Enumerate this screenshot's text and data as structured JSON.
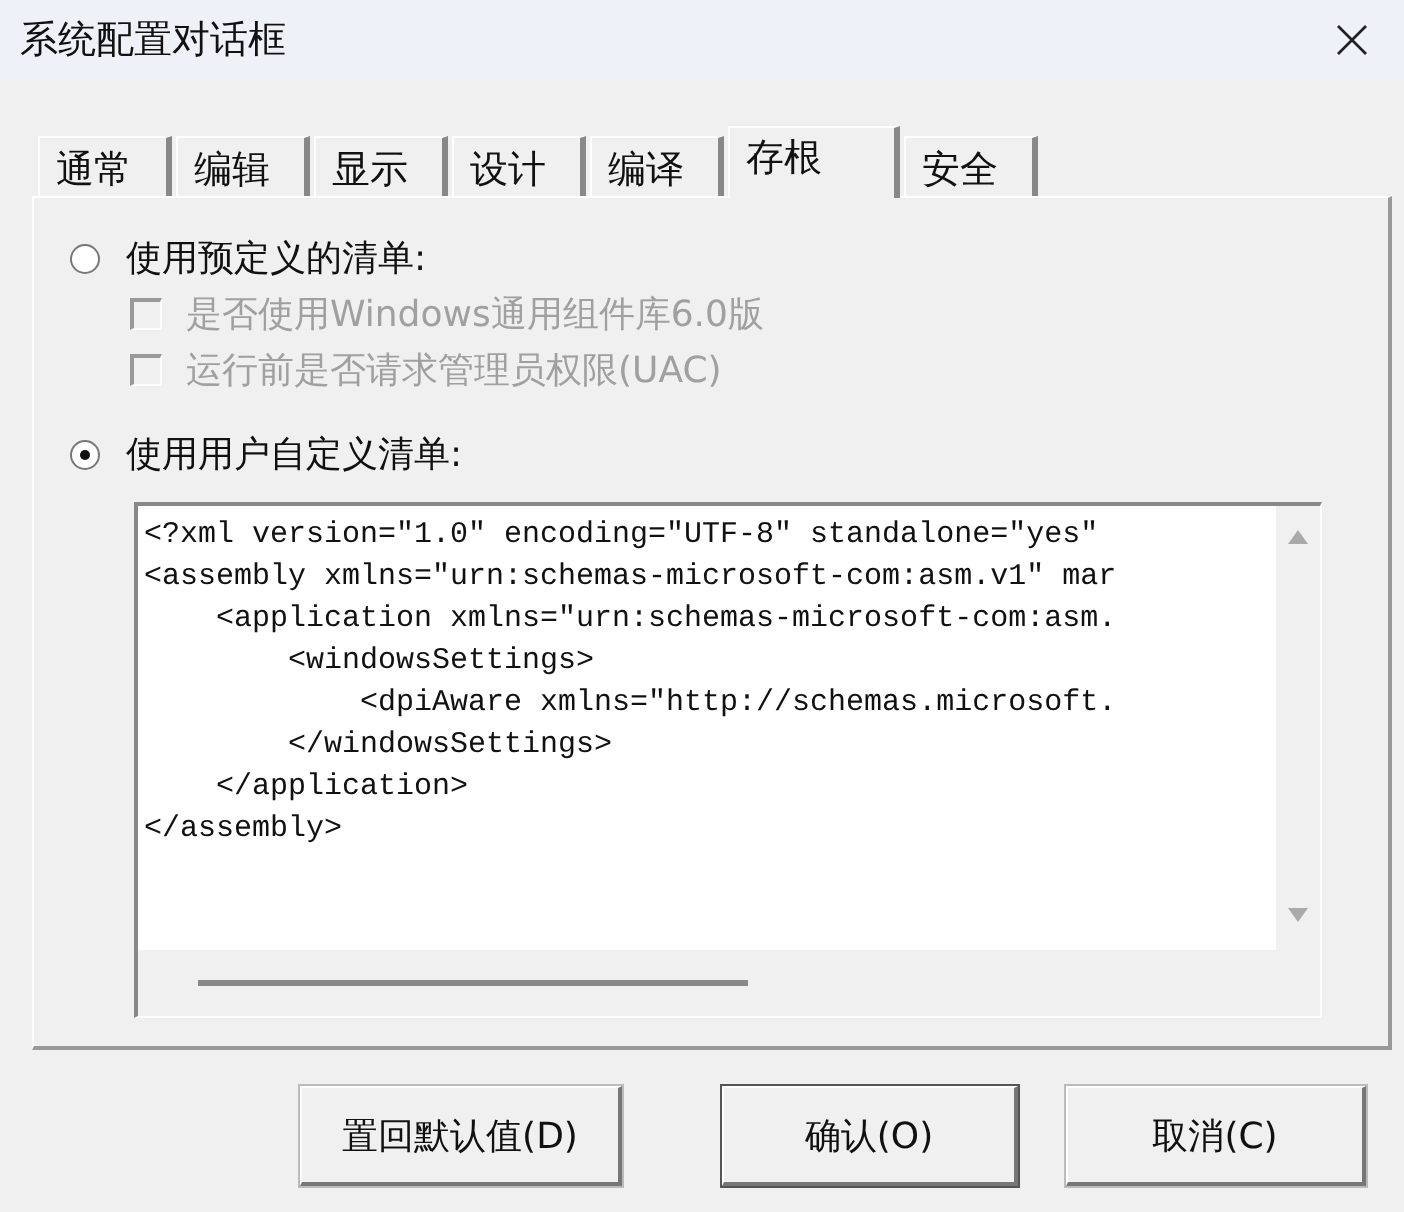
{
  "window": {
    "title": "系统配置对话框"
  },
  "tabs": [
    {
      "label": "通常",
      "selected": false
    },
    {
      "label": "编辑",
      "selected": false
    },
    {
      "label": "显示",
      "selected": false
    },
    {
      "label": "设计",
      "selected": false
    },
    {
      "label": "编译",
      "selected": false
    },
    {
      "label": "存根",
      "selected": true
    },
    {
      "label": "安全",
      "selected": false
    }
  ],
  "options": [
    {
      "kind": "radio",
      "label": "使用预定义的清单:",
      "selected": false,
      "children": [
        {
          "kind": "checkbox",
          "label": "是否使用Windows通用组件库6.0版",
          "checked": false,
          "disabled": true
        },
        {
          "kind": "checkbox",
          "label": "运行前是否请求管理员权限(UAC)",
          "checked": false,
          "disabled": true
        }
      ]
    },
    {
      "kind": "radio",
      "label": "使用用户自定义清单:",
      "selected": true
    }
  ],
  "manifest_editor": {
    "lines": [
      "<?xml version=\"1.0\" encoding=\"UTF-8\" standalone=\"yes\"",
      "<assembly xmlns=\"urn:schemas-microsoft-com:asm.v1\" mar",
      "    <application xmlns=\"urn:schemas-microsoft-com:asm.",
      "        <windowsSettings>",
      "            <dpiAware xmlns=\"http://schemas.microsoft.",
      "        </windowsSettings>",
      "    </application>",
      "</assembly>"
    ]
  },
  "buttons": [
    {
      "label": "置回默认值(D)",
      "default": false
    },
    {
      "label": "确认(O)",
      "default": true
    },
    {
      "label": "取消(C)",
      "default": false
    }
  ]
}
